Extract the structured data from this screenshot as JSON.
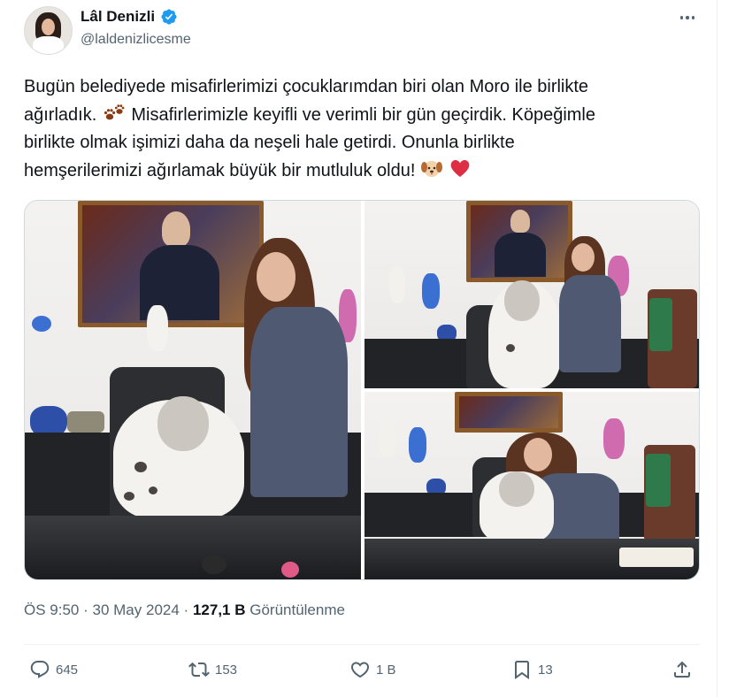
{
  "author": {
    "name": "Lâl Denizli",
    "handle": "@laldenizlicesme",
    "verified": true,
    "verified_color": "#1d9bf0"
  },
  "tweet": {
    "lines": [
      "Bugün belediyede misafirlerimizi çocuklarımdan biri olan Moro ile birlikte",
      "ağırladık.",
      "Misafirlerimizle  keyifli ve verimli bir gün geçirdik. Köpeğimle",
      "birlikte olmak işimizi daha da neşeli hale getirdi. Onunla birlikte",
      "hemşerilerimizi ağırlamak büyük bir mutluluk oldu!"
    ],
    "emoji": [
      "paw-prints",
      "dog-face",
      "red-heart"
    ]
  },
  "meta": {
    "time": "ÖS 9:50",
    "separator": "·",
    "date": "30 May 2024",
    "views_count": "127,1 B",
    "views_label": "Görüntülenme"
  },
  "actions": {
    "reply": {
      "icon": "reply-icon",
      "count": "645"
    },
    "retweet": {
      "icon": "retweet-icon",
      "count": "153"
    },
    "like": {
      "icon": "heart-icon",
      "count": "1 B"
    },
    "bookmark": {
      "icon": "bookmark-icon",
      "count": "13"
    },
    "share": {
      "icon": "share-icon"
    }
  },
  "colors": {
    "text": "#0f1419",
    "secondary": "#536471",
    "divider": "#eff3f4",
    "heart": "#e0245e"
  }
}
